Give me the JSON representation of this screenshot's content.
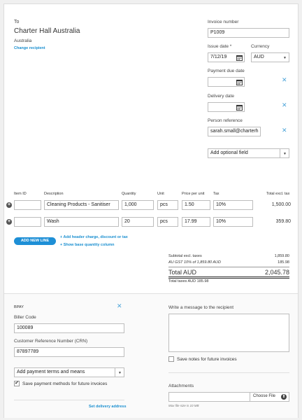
{
  "recipient": {
    "to_label": "To",
    "name": "Charter Hall Australia",
    "country": "Australia",
    "change_link": "Change recipient"
  },
  "invoice": {
    "number_label": "Invoice number",
    "number_value": "P1009",
    "issue_date_label": "Issue date *",
    "issue_date_value": "7/12/19",
    "currency_label": "Currency",
    "currency_value": "AUD",
    "payment_due_label": "Payment due date",
    "delivery_date_label": "Delivery date",
    "person_ref_label": "Person reference",
    "person_ref_value": "sarah.small@charterh",
    "optional_field_label": "Add optional field"
  },
  "items": {
    "headers": {
      "item_id": "Item ID",
      "description": "Description",
      "quantity": "Quantity",
      "unit": "Unit",
      "price": "Price per unit",
      "tax": "Tax",
      "total": "Total excl. tax"
    },
    "rows": [
      {
        "item_id": "",
        "description": "Cleaning Products - Sanitiser",
        "quantity": "1,000",
        "unit": "pcs",
        "price": "1.50",
        "tax": "10%",
        "total": "1,500.00"
      },
      {
        "item_id": "",
        "description": "Wash",
        "quantity": "20",
        "unit": "pcs",
        "price": "17.99",
        "tax": "10%",
        "total": "359.80"
      }
    ],
    "add_line_label": "ADD NEW LINE",
    "add_header_charge": "Add header charge, discount or tax",
    "show_base_qty": "Show base quantity column"
  },
  "totals": {
    "subtotal_label": "Subtotal excl. taxes",
    "subtotal_value": "1,859.80",
    "gst_label": "AU GST 10% of 1,859.80 AUD",
    "gst_value": "185.98",
    "total_label": "Total AUD",
    "total_value": "2,045.78",
    "total_taxes_label": "Total taxes AUD 185.98"
  },
  "payment": {
    "bpay_label": "BPAY",
    "biller_code_label": "Biller Code",
    "biller_code_value": "100089",
    "crn_label": "Customer Reference Number (CRN)",
    "crn_value": "87897789",
    "terms_label": "Add payment terms and means",
    "save_methods_label": "Save payment methods for future invoices",
    "delivery_address_link": "Set delivery address"
  },
  "message": {
    "label": "Write a message to the recipient",
    "save_notes_label": "Save notes for future invoices",
    "attachments_label": "Attachments",
    "choose_file_label": "Choose File",
    "max_size_note": "Max file size is 10 MB"
  },
  "colors": {
    "accent": "#1a8fd0",
    "button": "#1e8fd6"
  }
}
